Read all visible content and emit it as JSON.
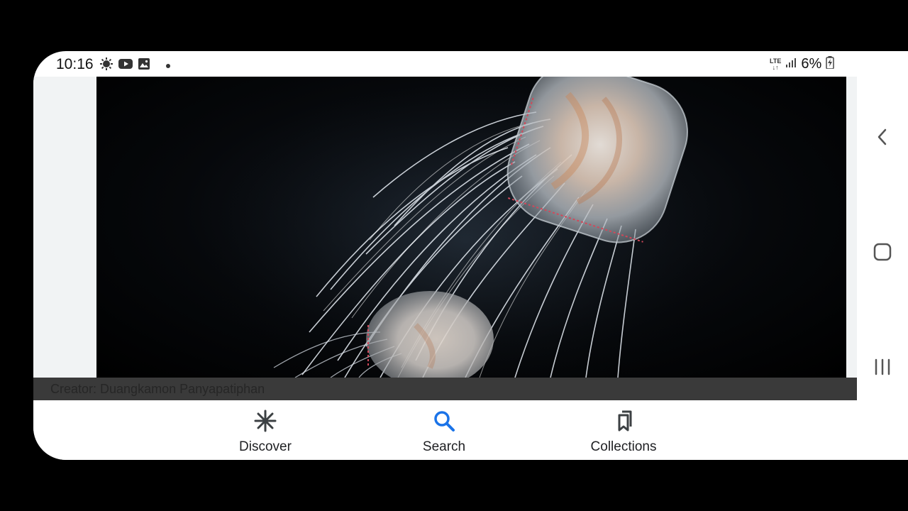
{
  "status_bar": {
    "time": "10:16",
    "left_icons": [
      "brightness-icon",
      "youtube-icon",
      "gallery-icon",
      "notification-dot-icon"
    ],
    "network": "LTE",
    "battery": "6%"
  },
  "content": {
    "image_subject": "jellyfish-photo",
    "caption": "Creator: Duangkamon Panyapatiphan"
  },
  "bottom_nav": {
    "items": [
      {
        "label": "Discover",
        "icon": "asterisk-icon"
      },
      {
        "label": "Search",
        "icon": "search-icon"
      },
      {
        "label": "Collections",
        "icon": "bookmarks-icon"
      }
    ],
    "active": "Search",
    "active_color": "#1a73e8"
  },
  "system_nav": {
    "buttons": [
      "back-icon",
      "home-icon",
      "recent-apps-icon"
    ]
  }
}
